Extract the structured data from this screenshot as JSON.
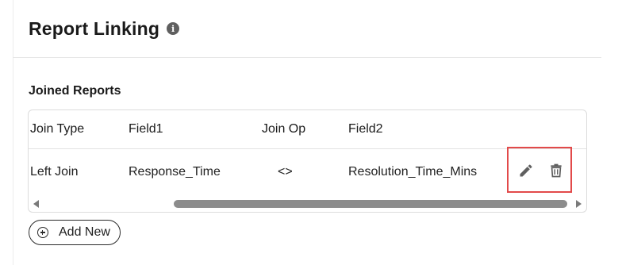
{
  "page": {
    "title": "Report Linking",
    "info_icon": "info-icon"
  },
  "joined_reports": {
    "section_title": "Joined Reports",
    "columns": [
      "Join Type",
      "Field1",
      "Join Op",
      "Field2"
    ],
    "rows": [
      {
        "join_type": "Left Join",
        "field1": "Response_Time",
        "join_op": "<>",
        "field2": "Resolution_Time_Mins",
        "actions": [
          "pencil-icon",
          "trash-icon"
        ]
      }
    ]
  },
  "add_button": {
    "label": "Add New",
    "icon": "plus-circle-icon"
  },
  "colors": {
    "highlight_border": "#e24a4a",
    "scrollbar_thumb": "#8c8c8c",
    "icon_gray": "#5f5f5f"
  }
}
